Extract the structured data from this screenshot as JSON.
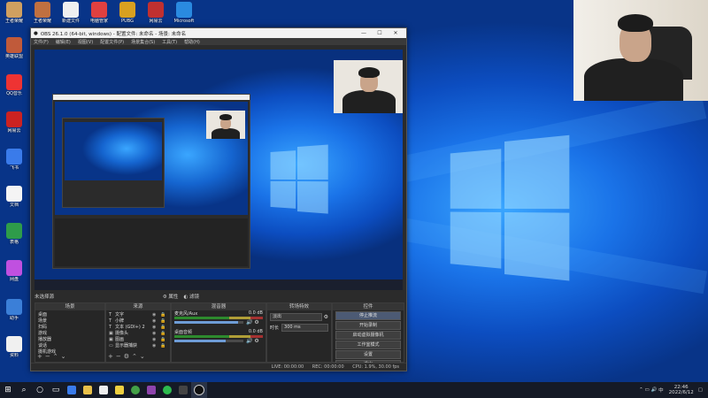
{
  "obs": {
    "title": "OBS 26.1.0 (64-bit, windows) - 配置文件: 未命名 - 场景: 未命名",
    "menu": [
      "文件(F)",
      "编辑(E)",
      "视图(V)",
      "配置文件(P)",
      "场景集合(S)",
      "工具(T)",
      "帮助(H)"
    ],
    "status_left": "未选择源",
    "props_btn": "属性",
    "filter_btn": "滤镜",
    "docks": {
      "scenes": {
        "title": "场景",
        "items": [
          "桌面",
          "场景",
          "扫码",
          "游戏",
          "播放器",
          "谈话",
          "摄机游戏"
        ]
      },
      "sources": {
        "title": "来源",
        "items": [
          {
            "icon": "T",
            "name": "文字"
          },
          {
            "icon": "T",
            "name": "小牌"
          },
          {
            "icon": "T",
            "name": "文本 (GDI+) 2"
          },
          {
            "icon": "▣",
            "name": "摄像头"
          },
          {
            "icon": "▣",
            "name": "图画"
          },
          {
            "icon": "▭",
            "name": "显示器捕获"
          }
        ]
      },
      "mixer": {
        "title": "混音器",
        "channels": [
          {
            "name": "麦克风/Aux",
            "db": "0.0 dB",
            "level": 0.92
          },
          {
            "name": "桌面音频",
            "db": "0.0 dB",
            "level": 0.74
          }
        ]
      },
      "transitions": {
        "title": "转场特效",
        "type": "淡出",
        "duration_label": "时长",
        "duration": "300 ms"
      },
      "controls": {
        "title": "控件",
        "buttons": [
          "停止推流",
          "开始录制",
          "启动虚拟摄像机",
          "工作室模式",
          "设置",
          "退出"
        ]
      }
    },
    "statusbar": {
      "live": "LIVE: 00:00:00",
      "rec": "REC: 00:00:00",
      "cpu": "CPU: 1.9%, 30.00 fps"
    }
  },
  "taskbar": {
    "time": "22:46",
    "date": "2022/6/12"
  },
  "desktop_icons": [
    {
      "label": "王者荣耀",
      "color": "#d0a060"
    },
    {
      "label": "英雄联盟",
      "color": "#c05a3a"
    },
    {
      "label": "QQ音乐",
      "color": "#e33"
    },
    {
      "label": "网易云",
      "color": "#c22"
    },
    {
      "label": "飞书",
      "color": "#3a7bea"
    },
    {
      "label": "文档",
      "color": "#f4f4f4"
    },
    {
      "label": "表格",
      "color": "#2e9c4a"
    },
    {
      "label": "网盘",
      "color": "#c050e0"
    },
    {
      "label": "助手",
      "color": "#3b7fd8"
    },
    {
      "label": "资料",
      "color": "#f0f0f0"
    }
  ],
  "top_icons": [
    {
      "label": "王者荣耀",
      "color": "#c07040"
    },
    {
      "label": "新建文件",
      "color": "#f0f0f0"
    },
    {
      "label": "电脑管家",
      "color": "#e04040"
    },
    {
      "label": "PUBG",
      "color": "#d8a020"
    },
    {
      "label": "网易云",
      "color": "#c03030"
    },
    {
      "label": "Microsoft",
      "color": "#2a8ae0"
    }
  ]
}
